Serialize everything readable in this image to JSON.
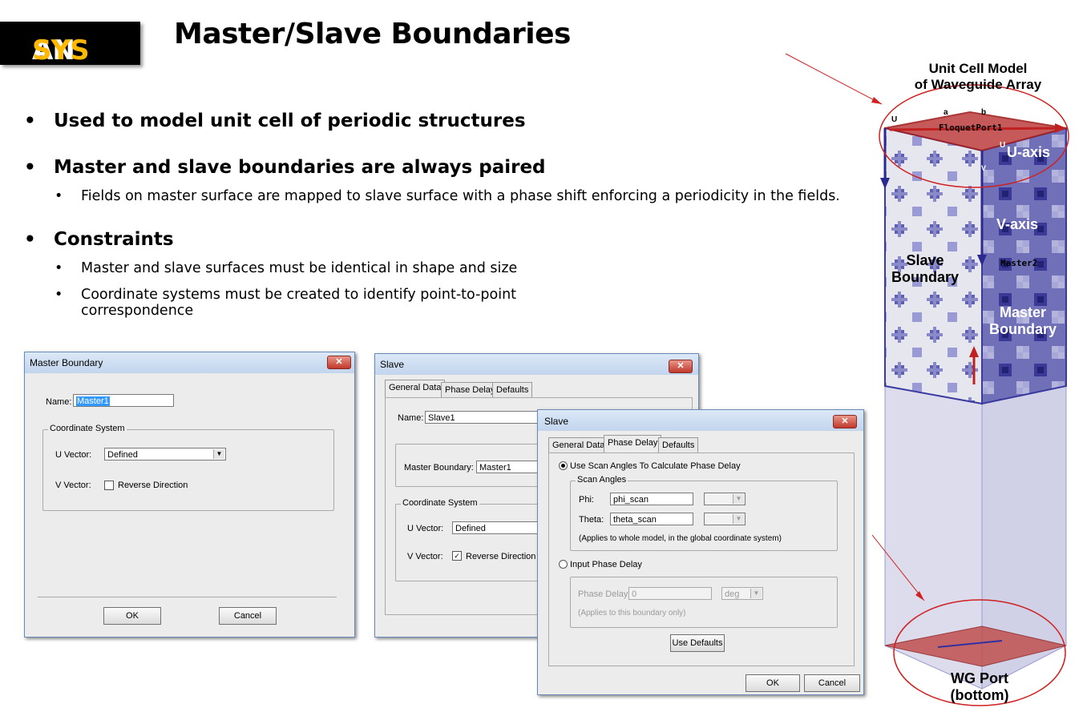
{
  "header": {
    "logo_an": "AN",
    "logo_sys": "SYS",
    "title": "Master/Slave Boundaries"
  },
  "bullets": {
    "b1": "Used to model unit cell of periodic structures",
    "b2": "Master and slave boundaries are always paired",
    "b2_sub1": "Fields on master surface are mapped to slave surface with a phase shift enforcing a periodicity in the fields.",
    "b3": "Constraints",
    "b3_sub1": "Master and slave surfaces must be identical in shape and size",
    "b3_sub2a": "Coordinate systems must be created to identify point-to-point",
    "b3_sub2b": "correspondence"
  },
  "master_dialog": {
    "title": "Master Boundary",
    "close": "✕",
    "name_label": "Name:",
    "name_value": "Master1",
    "coord_group": "Coordinate System",
    "u_vector_label": "U  Vector:",
    "u_vector_value": "Defined",
    "v_vector_label": "V  Vector:",
    "reverse_label": "Reverse Direction",
    "ok": "OK",
    "cancel": "Cancel"
  },
  "slave_dialog": {
    "title": "Slave",
    "close": "✕",
    "tabs": [
      "General Data",
      "Phase Delay",
      "Defaults"
    ],
    "name_label": "Name:",
    "name_value": "Slave1",
    "master_label": "Master Boundary:",
    "master_value": "Master1",
    "coord_group": "Coordinate System",
    "u_vector_label": "U  Vector:",
    "u_vector_value": "Defined",
    "v_vector_label": "V  Vector:",
    "reverse_label": "Reverse Direction",
    "reverse_checked": "✓"
  },
  "phase_dialog": {
    "title": "Slave",
    "close": "✕",
    "tabs": [
      "General Data",
      "Phase Delay",
      "Defaults"
    ],
    "use_scan_label": "Use Scan Angles To Calculate Phase Delay",
    "scan_group": "Scan Angles",
    "phi_label": "Phi:",
    "phi_value": "phi_scan",
    "theta_label": "Theta:",
    "theta_value": "theta_scan",
    "applies_global": "(Applies to whole model, in the global coordinate system)",
    "input_phase_label": "Input Phase Delay",
    "phase_delay_label": "Phase Delay:",
    "phase_delay_value": "0",
    "unit_value": "deg",
    "applies_boundary": "(Applies to this boundary only)",
    "use_defaults": "Use Defaults",
    "ok": "OK",
    "cancel": "Cancel"
  },
  "model": {
    "unit_cell_line1": "Unit Cell Model",
    "unit_cell_line2": "of Waveguide Array",
    "floquet": "FloquetPort1",
    "tick_a": "a",
    "tick_b": "b",
    "tick_u": "U",
    "tick_u2": "U",
    "tick_v": "V",
    "u_axis": "U-axis",
    "v_axis": "V-axis",
    "master2": "Master2",
    "slave_line1": "Slave",
    "slave_line2": "Boundary",
    "master_line1": "Master",
    "master_line2": "Boundary",
    "wg_line1": "WG Port",
    "wg_line2": "(bottom)"
  },
  "colors": {
    "logo_accent": "#ffb800",
    "boundary_blue": "#3a3aa0",
    "callout_red": "#d02020"
  }
}
